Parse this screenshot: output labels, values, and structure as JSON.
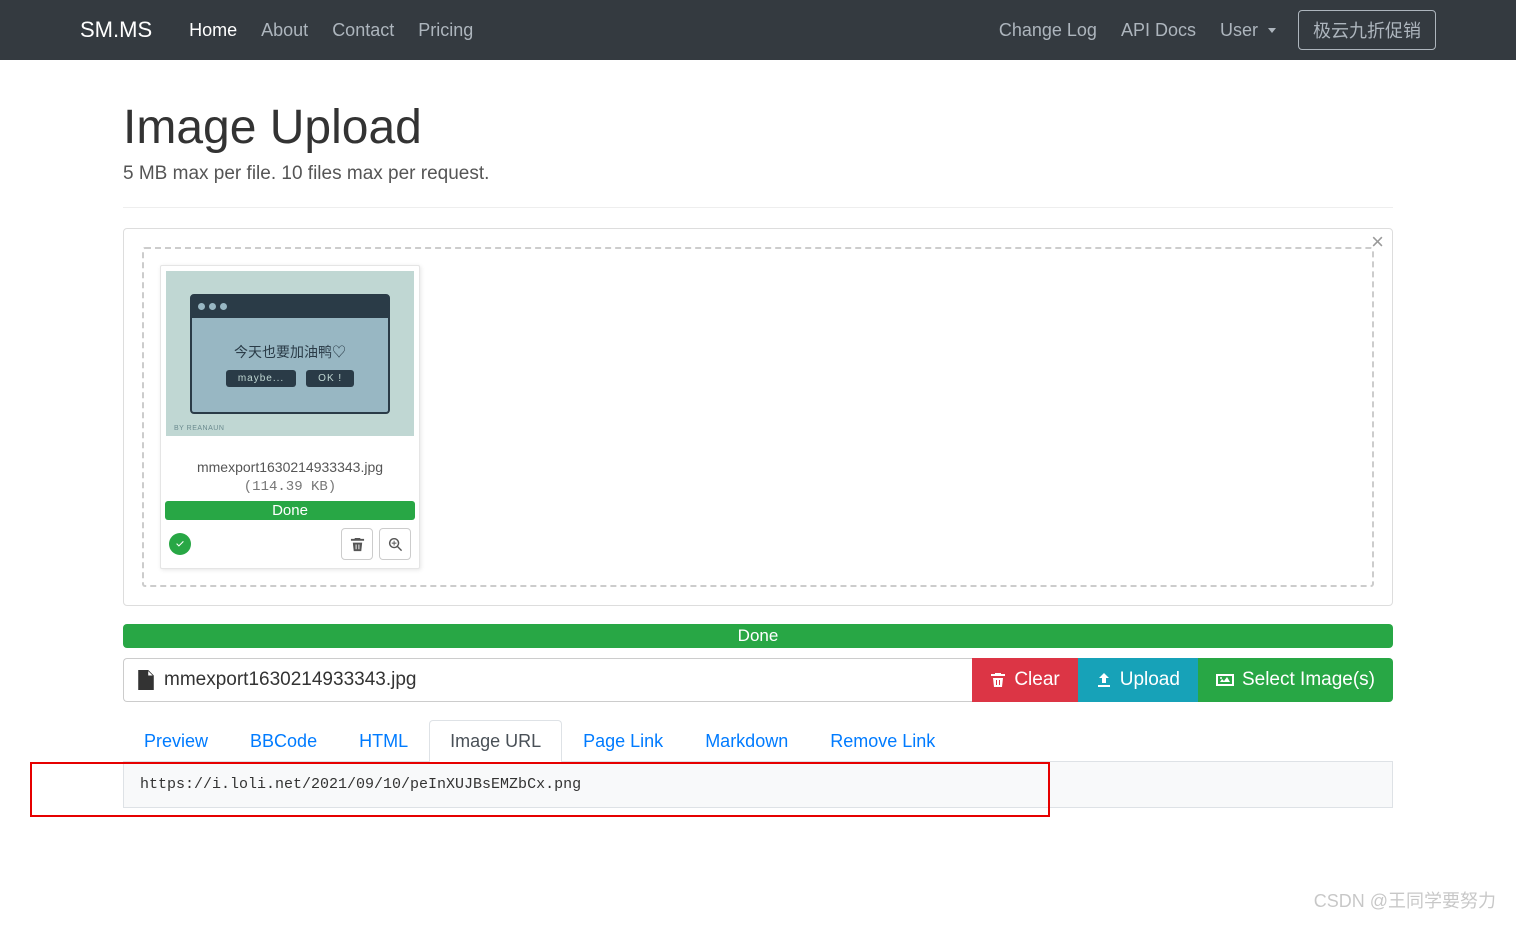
{
  "nav": {
    "brand": "SM.MS",
    "left": [
      {
        "label": "Home",
        "active": true
      },
      {
        "label": "About",
        "active": false
      },
      {
        "label": "Contact",
        "active": false
      },
      {
        "label": "Pricing",
        "active": false
      }
    ],
    "right": [
      {
        "label": "Change Log"
      },
      {
        "label": "API Docs"
      },
      {
        "label": "User",
        "dropdown": true
      }
    ],
    "promo_button": "极云九折促销"
  },
  "page": {
    "title": "Image Upload",
    "subtitle": "5 MB max per file. 10 files max per request."
  },
  "thumb": {
    "heading": "今天也要加油鸭♡",
    "btn1": "maybe...",
    "btn2": "OK !",
    "credit": "BY REANAUN"
  },
  "file": {
    "name_in_card": "mmexport1630214933343.jpg",
    "size": "(114.39 KB)",
    "status": "Done",
    "name_in_bar": "mmexport1630214933343.jpg"
  },
  "global_progress": "Done",
  "toolbar": {
    "clear": "Clear",
    "upload": "Upload",
    "select": "Select Image(s)"
  },
  "tabs": [
    {
      "label": "Preview",
      "active": false
    },
    {
      "label": "BBCode",
      "active": false
    },
    {
      "label": "HTML",
      "active": false
    },
    {
      "label": "Image URL",
      "active": true
    },
    {
      "label": "Page Link",
      "active": false
    },
    {
      "label": "Markdown",
      "active": false
    },
    {
      "label": "Remove Link",
      "active": false
    }
  ],
  "image_url": "https://i.loli.net/2021/09/10/peInXUJBsEMZbCx.png",
  "watermark": "CSDN @王同学要努力"
}
